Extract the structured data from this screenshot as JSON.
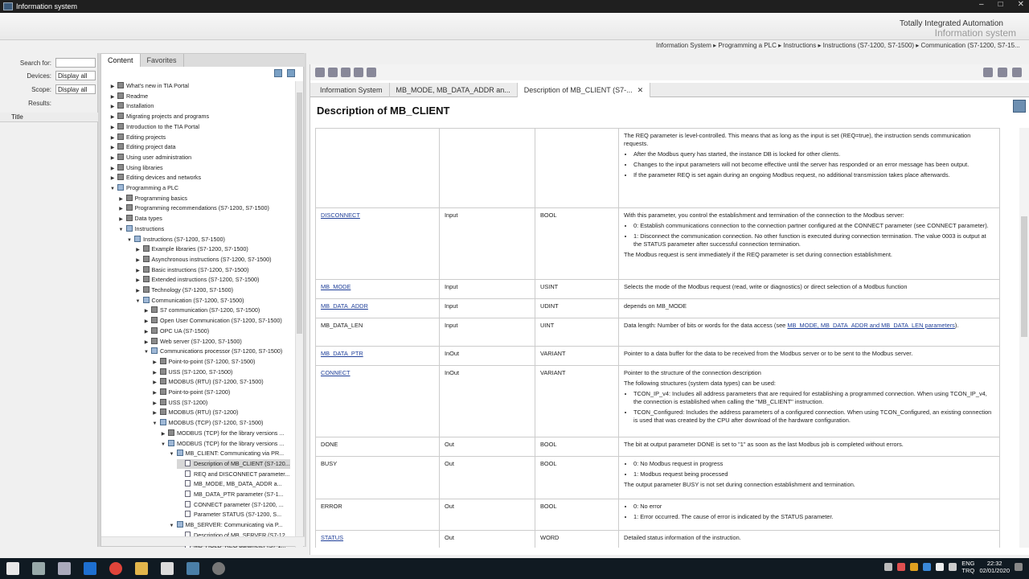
{
  "window": {
    "title": "Information system",
    "controls": [
      "–",
      "□",
      "✕"
    ]
  },
  "banner": {
    "line1": "Totally Integrated Automation",
    "line2": "Information system"
  },
  "breadcrumb": "Information System ▸ Programming a PLC ▸ Instructions ▸ Instructions (S7-1200, S7-1500) ▸ Communication (S7-1200, S7-15...",
  "search": {
    "search_label": "Search for:",
    "search_value": "",
    "devices_label": "Devices:",
    "devices_value": "Display all",
    "scope_label": "Scope:",
    "scope_value": "Display all",
    "results_label": "Results:",
    "results_col_title": "Title"
  },
  "tree_tabs": [
    "Content",
    "Favorites"
  ],
  "tree": [
    {
      "t": "What's new in TIA Portal",
      "l": 0,
      "e": "▶"
    },
    {
      "t": "Readme",
      "l": 0,
      "e": "▶"
    },
    {
      "t": "Installation",
      "l": 0,
      "e": "▶"
    },
    {
      "t": "Migrating projects and programs",
      "l": 0,
      "e": "▶"
    },
    {
      "t": "Introduction to the TIA Portal",
      "l": 0,
      "e": "▶"
    },
    {
      "t": "Editing projects",
      "l": 0,
      "e": "▶"
    },
    {
      "t": "Editing project data",
      "l": 0,
      "e": "▶"
    },
    {
      "t": "Using user administration",
      "l": 0,
      "e": "▶"
    },
    {
      "t": "Using libraries",
      "l": 0,
      "e": "▶"
    },
    {
      "t": "Editing devices and networks",
      "l": 0,
      "e": "▶"
    },
    {
      "t": "Programming a PLC",
      "l": 0,
      "e": "▼",
      "open": true
    },
    {
      "t": "Programming basics",
      "l": 1,
      "e": "▶"
    },
    {
      "t": "Programming recommendations (S7-1200, S7-1500)",
      "l": 1,
      "e": "▶"
    },
    {
      "t": "Data types",
      "l": 1,
      "e": "▶"
    },
    {
      "t": "Instructions",
      "l": 1,
      "e": "▼",
      "open": true
    },
    {
      "t": "Instructions (S7-1200, S7-1500)",
      "l": 2,
      "e": "▼",
      "open": true
    },
    {
      "t": "Example libraries (S7-1200, S7-1500)",
      "l": 3,
      "e": "▶"
    },
    {
      "t": "Asynchronous instructions (S7-1200, S7-1500)",
      "l": 3,
      "e": "▶"
    },
    {
      "t": "Basic instructions (S7-1200, S7-1500)",
      "l": 3,
      "e": "▶"
    },
    {
      "t": "Extended instructions (S7-1200, S7-1500)",
      "l": 3,
      "e": "▶"
    },
    {
      "t": "Technology (S7-1200, S7-1500)",
      "l": 3,
      "e": "▶"
    },
    {
      "t": "Communication (S7-1200, S7-1500)",
      "l": 3,
      "e": "▼",
      "open": true
    },
    {
      "t": "S7 communication (S7-1200, S7-1500)",
      "l": 4,
      "e": "▶"
    },
    {
      "t": "Open User Communication (S7-1200, S7-1500)",
      "l": 4,
      "e": "▶"
    },
    {
      "t": "OPC UA (S7-1500)",
      "l": 4,
      "e": "▶"
    },
    {
      "t": "Web server (S7-1200, S7-1500)",
      "l": 4,
      "e": "▶"
    },
    {
      "t": "Communications processor (S7-1200, S7-1500)",
      "l": 4,
      "e": "▼",
      "open": true
    },
    {
      "t": "Point-to-point (S7-1200, S7-1500)",
      "l": 5,
      "e": "▶"
    },
    {
      "t": "USS (S7-1200, S7-1500)",
      "l": 5,
      "e": "▶"
    },
    {
      "t": "MODBUS (RTU) (S7-1200, S7-1500)",
      "l": 5,
      "e": "▶"
    },
    {
      "t": "Point-to-point (S7-1200)",
      "l": 5,
      "e": "▶"
    },
    {
      "t": "USS (S7-1200)",
      "l": 5,
      "e": "▶"
    },
    {
      "t": "MODBUS (RTU) (S7-1200)",
      "l": 5,
      "e": "▶"
    },
    {
      "t": "MODBUS (TCP) (S7-1200, S7-1500)",
      "l": 5,
      "e": "▼",
      "open": true
    },
    {
      "t": "MODBUS (TCP) for the library versions ...",
      "l": 6,
      "e": "▶"
    },
    {
      "t": "MODBUS (TCP) for the library versions ...",
      "l": 6,
      "e": "▼",
      "open": true
    },
    {
      "t": "MB_CLIENT: Communicating via PR...",
      "l": 7,
      "e": "▼",
      "open": true
    },
    {
      "t": "Description of MB_CLIENT (S7-120...",
      "l": 8,
      "e": "",
      "page": true,
      "sel": true
    },
    {
      "t": "REQ and DISCONNECT parameter...",
      "l": 8,
      "e": "",
      "page": true
    },
    {
      "t": "MB_MODE, MB_DATA_ADDR a...",
      "l": 8,
      "e": "",
      "page": true
    },
    {
      "t": "MB_DATA_PTR parameter (S7-1...",
      "l": 8,
      "e": "",
      "page": true
    },
    {
      "t": "CONNECT parameter (S7-1200, ...",
      "l": 8,
      "e": "",
      "page": true
    },
    {
      "t": "Parameter STATUS (S7-1200, S...",
      "l": 8,
      "e": "",
      "page": true
    },
    {
      "t": "MB_SERVER: Communicating via P...",
      "l": 7,
      "e": "▼",
      "open": true
    },
    {
      "t": "Description of MB_SERVER (S7-12...",
      "l": 8,
      "e": "",
      "page": true
    },
    {
      "t": "MB_HOLD_REG parameter (S7-1...",
      "l": 8,
      "e": "",
      "page": true
    }
  ],
  "content_tabs": [
    {
      "label": "Information System",
      "active": false
    },
    {
      "label": "MB_MODE, MB_DATA_ADDR an...",
      "active": false
    },
    {
      "label": "Description of MB_CLIENT (S7-...",
      "active": true,
      "close": "✕"
    }
  ],
  "page_title": "Description of MB_CLIENT",
  "rows": [
    {
      "name": "",
      "link": false,
      "decl": "",
      "type": "",
      "desc": [
        {
          "p": "The REQ parameter is level-controlled. This means that as long as the input is set (REQ=true), the instruction sends communication requests."
        },
        {
          "li": "After the Modbus query has started, the instance DB is locked for other clients."
        },
        {
          "li": "Changes to the input parameters will not become effective until the server has responded or an error message has been output."
        },
        {
          "li": "If the parameter REQ is set again during an ongoing Modbus request, no additional transmission takes place afterwards."
        }
      ]
    },
    {
      "name": "DISCONNECT",
      "link": true,
      "decl": "Input",
      "type": "BOOL",
      "desc": [
        {
          "p": "With this parameter, you control the establishment and termination of the connection to the Modbus server:"
        },
        {
          "li": "0: Establish communications connection to the connection partner configured at the CONNECT parameter (see CONNECT parameter)."
        },
        {
          "li": "1: Disconnect the communication connection. No other function is executed during connection termination. The value 0003 is output at the STATUS parameter after successful connection termination."
        },
        {
          "p": "The Modbus request is sent immediately if the REQ parameter is set during connection establishment."
        }
      ]
    },
    {
      "name": "MB_MODE",
      "link": true,
      "decl": "Input",
      "type": "USINT",
      "desc": [
        {
          "p": "Selects the mode of the Modbus request (read, write or diagnostics) or direct selection of a Modbus function"
        }
      ]
    },
    {
      "name": "MB_DATA_ADDR",
      "link": true,
      "decl": "Input",
      "type": "UDINT",
      "desc": [
        {
          "p": "depends on MB_MODE"
        }
      ]
    },
    {
      "name": "MB_DATA_LEN",
      "link": false,
      "decl": "Input",
      "type": "UINT",
      "desc": [
        {
          "p": "Data length: Number of bits or words for the data access (see ",
          "a": "MB_MODE, MB_DATA_ADDR and MB_DATA_LEN parameters",
          "after": ")."
        }
      ]
    },
    {
      "name": "MB_DATA_PTR",
      "link": true,
      "decl": "InOut",
      "type": "VARIANT",
      "desc": [
        {
          "p": "Pointer to a data buffer for the data to be received from the Modbus server or to be sent to the Modbus server."
        }
      ]
    },
    {
      "name": "CONNECT",
      "link": true,
      "decl": "InOut",
      "type": "VARIANT",
      "desc": [
        {
          "p": "Pointer to the structure of the connection description"
        },
        {
          "p": "The following structures (system data types) can be used:"
        },
        {
          "li": "TCON_IP_v4: Includes all address parameters that are required for establishing a programmed connection. When using TCON_IP_v4, the connection is established when calling the \"MB_CLIENT\" instruction."
        },
        {
          "li": "TCON_Configured: Includes the address parameters of a configured connection. When using TCON_Configured, an existing connection is used that was created by the CPU after download of the hardware configuration."
        }
      ]
    },
    {
      "name": "DONE",
      "link": false,
      "decl": "Out",
      "type": "BOOL",
      "desc": [
        {
          "p": "The bit at output parameter DONE is set to \"1\" as soon as the last Modbus job is completed without errors."
        }
      ]
    },
    {
      "name": "BUSY",
      "link": false,
      "decl": "Out",
      "type": "BOOL",
      "desc": [
        {
          "li": "0: No Modbus request in progress"
        },
        {
          "li": "1: Modbus request being processed"
        },
        {
          "p": "The output parameter BUSY is not set during connection establishment and termination."
        }
      ]
    },
    {
      "name": "ERROR",
      "link": false,
      "decl": "Out",
      "type": "BOOL",
      "desc": [
        {
          "li": "0: No error"
        },
        {
          "li": "1: Error occurred. The cause of error is indicated by the STATUS parameter."
        }
      ]
    },
    {
      "name": "STATUS",
      "link": true,
      "decl": "Out",
      "type": "WORD",
      "desc": [
        {
          "p": "Detailed status information of the instruction."
        }
      ]
    }
  ],
  "taskbar": {
    "lang1": "ENG",
    "lang2": "TRQ",
    "time": "22:32",
    "date": "02/01/2020"
  },
  "colors": {
    "link": "#1f3f99",
    "titlebar": "#1f1f1f",
    "taskbar": "#101a22"
  }
}
